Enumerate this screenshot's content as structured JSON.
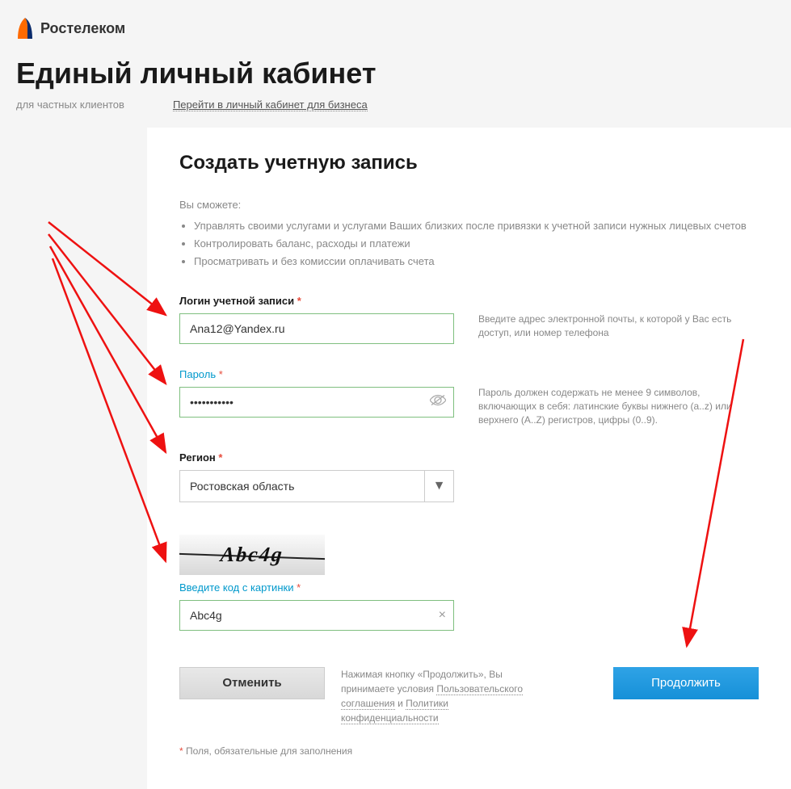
{
  "brand": "Ростелеком",
  "page_title": "Единый личный кабинет",
  "subtitle": "для частных клиентов",
  "biz_link": "Перейти в личный кабинет для бизнеса",
  "form": {
    "title": "Создать учетную запись",
    "intro_label": "Вы сможете:",
    "intro_items": [
      "Управлять своими услугами и услугами Ваших близких после привязки к учетной записи нужных лицевых счетов",
      "Контролировать баланс, расходы и платежи",
      "Просматривать и без комиссии оплачивать счета"
    ],
    "login": {
      "label": "Логин учетной записи",
      "value": "Ana12@Yandex.ru",
      "hint": "Введите адрес электронной почты, к которой у Вас есть доступ, или номер телефона"
    },
    "password": {
      "label": "Пароль",
      "value": "•••••••••••",
      "hint": "Пароль должен содержать не менее 9 символов, включающих в себя: латинские буквы нижнего (a..z) или верхнего (A..Z) регистров, цифры (0..9)."
    },
    "region": {
      "label": "Регион",
      "value": "Ростовская область"
    },
    "captcha": {
      "image_text": "Abc4g",
      "label": "Введите код с картинки",
      "value": "Abc4g"
    },
    "cancel_label": "Отменить",
    "continue_label": "Продолжить",
    "agree_prefix": "Нажимая кнопку «Продолжить», Вы принимаете условия ",
    "agree_link1": "Пользовательского соглашения",
    "agree_and": " и ",
    "agree_link2": "Политики конфиденциальности",
    "required_note": "Поля, обязательные для заполнения"
  }
}
